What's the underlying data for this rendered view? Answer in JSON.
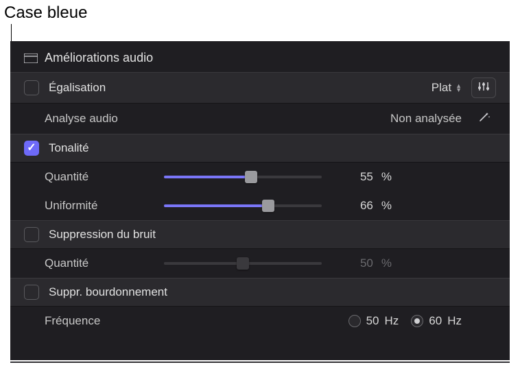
{
  "annotation": "Case bleue",
  "section_title": "Améliorations audio",
  "eq": {
    "label": "Égalisation",
    "checked": false,
    "preset": "Plat"
  },
  "analysis": {
    "label": "Analyse audio",
    "status": "Non analysée"
  },
  "tone": {
    "label": "Tonalité",
    "checked": true,
    "amount": {
      "label": "Quantité",
      "value": "55",
      "unit": "%",
      "pct": 55
    },
    "uniformity": {
      "label": "Uniformité",
      "value": "66",
      "unit": "%",
      "pct": 66
    }
  },
  "noise": {
    "label": "Suppression du bruit",
    "checked": false,
    "amount": {
      "label": "Quantité",
      "value": "50",
      "unit": "%",
      "pct": 50
    }
  },
  "hum": {
    "label": "Suppr. bourdonnement",
    "checked": false,
    "freq": {
      "label": "Fréquence",
      "options": [
        {
          "value": "50",
          "unit": "Hz",
          "selected": false
        },
        {
          "value": "60",
          "unit": "Hz",
          "selected": true
        }
      ]
    }
  }
}
